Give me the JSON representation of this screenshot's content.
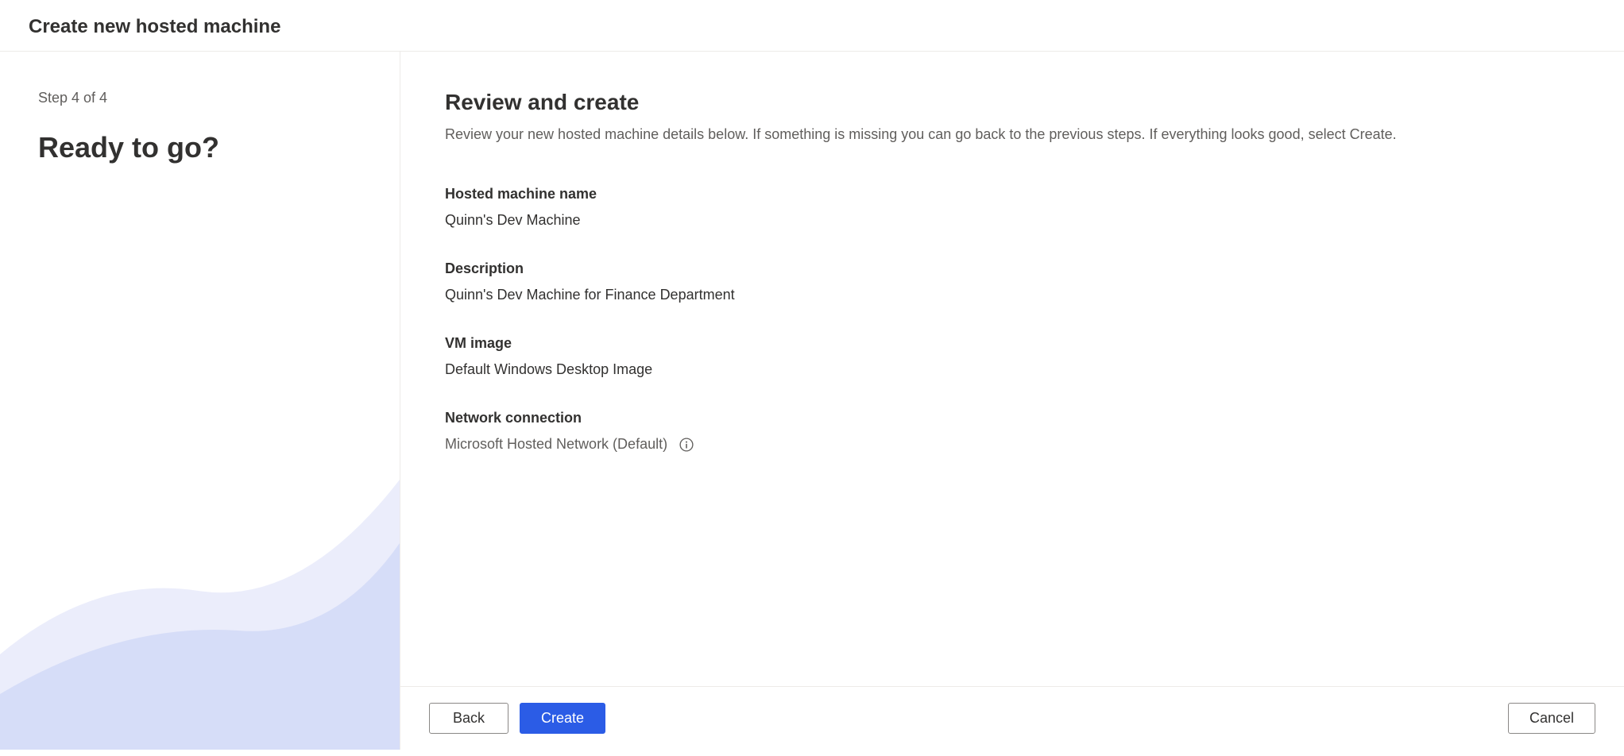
{
  "header": {
    "title": "Create new hosted machine"
  },
  "sidebar": {
    "step": "Step 4 of 4",
    "heading": "Ready to go?"
  },
  "main": {
    "title": "Review and create",
    "description": "Review your new hosted machine details below. If something is missing you can go back to the previous steps. If everything looks good, select Create.",
    "fields": {
      "machineName": {
        "label": "Hosted machine name",
        "value": "Quinn's Dev Machine"
      },
      "description": {
        "label": "Description",
        "value": "Quinn's Dev Machine for Finance Department"
      },
      "vmImage": {
        "label": "VM image",
        "value": "Default Windows Desktop Image"
      },
      "networkConnection": {
        "label": "Network connection",
        "value": "Microsoft Hosted Network (Default)"
      }
    }
  },
  "footer": {
    "back": "Back",
    "create": "Create",
    "cancel": "Cancel"
  }
}
